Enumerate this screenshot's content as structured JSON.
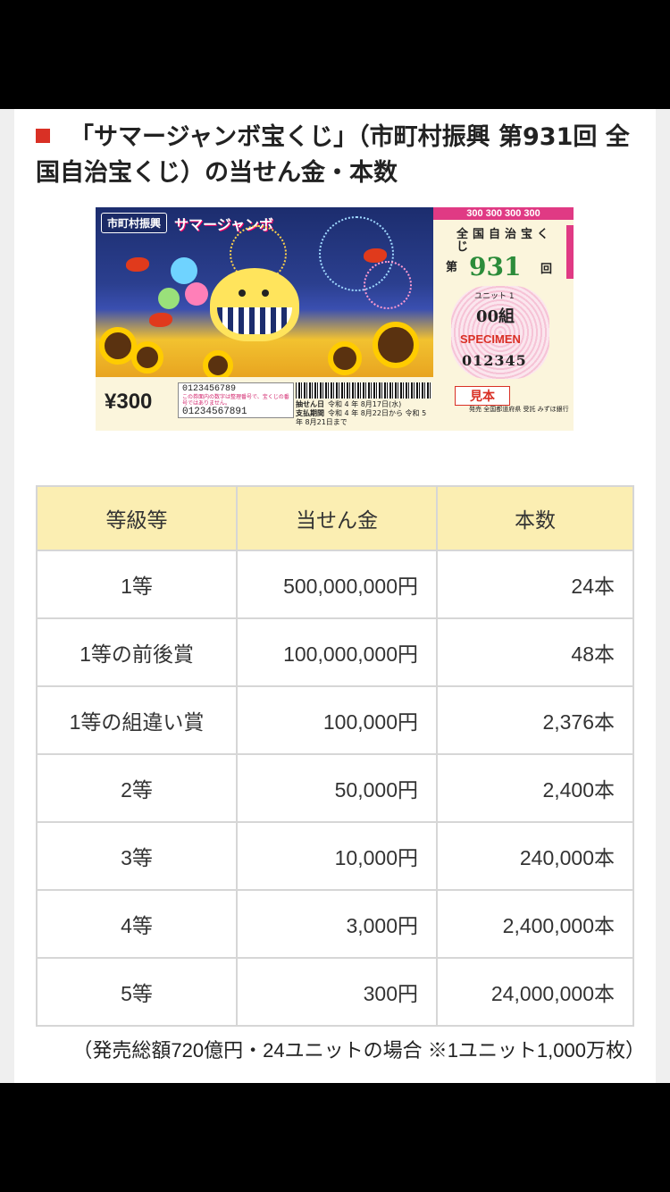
{
  "heading": "「サマージャンボ宝くじ」（市町村振興 第931回 全国自治宝くじ）の当せん金・本数",
  "colors": {
    "marker": "#d93025",
    "table_header_bg": "#fbeeb2"
  },
  "ticket": {
    "badge": "市町村振興",
    "brand": "サマージャンボ",
    "price": "¥300",
    "number_top": "0123456789",
    "number_note": "この券面内の数字は整理番号で、宝くじの番号ではありません。",
    "number_bottom": "01234567891",
    "draw_label": "抽せん日",
    "draw_date": "令和 4 年 8月17日(水)",
    "pay_label": "支払期間",
    "pay_period": "令和 4 年 8月22日から 令和 5 年 8月21日まで",
    "price_strip": "300 300 300 300",
    "kanji": "全国自治宝くじ",
    "dai": "第",
    "issue_no": "931",
    "kai": "回",
    "unit": "ユニット 1",
    "kumi": "00組",
    "specimen": "SPECIMEN",
    "serial": "012345",
    "mihon": "見本",
    "issuer": "発売 全国都道府県 受託 みずほ銀行"
  },
  "table": {
    "headers": [
      "等級等",
      "当せん金",
      "本数"
    ],
    "rows": [
      [
        "1等",
        "500,000,000円",
        "24本"
      ],
      [
        "1等の前後賞",
        "100,000,000円",
        "48本"
      ],
      [
        "1等の組違い賞",
        "100,000円",
        "2,376本"
      ],
      [
        "2等",
        "50,000円",
        "2,400本"
      ],
      [
        "3等",
        "10,000円",
        "240,000本"
      ],
      [
        "4等",
        "3,000円",
        "2,400,000本"
      ],
      [
        "5等",
        "300円",
        "24,000,000本"
      ]
    ]
  },
  "footnote": "（発売総額720億円・24ユニットの場合 ※1ユニット1,000万枚）"
}
